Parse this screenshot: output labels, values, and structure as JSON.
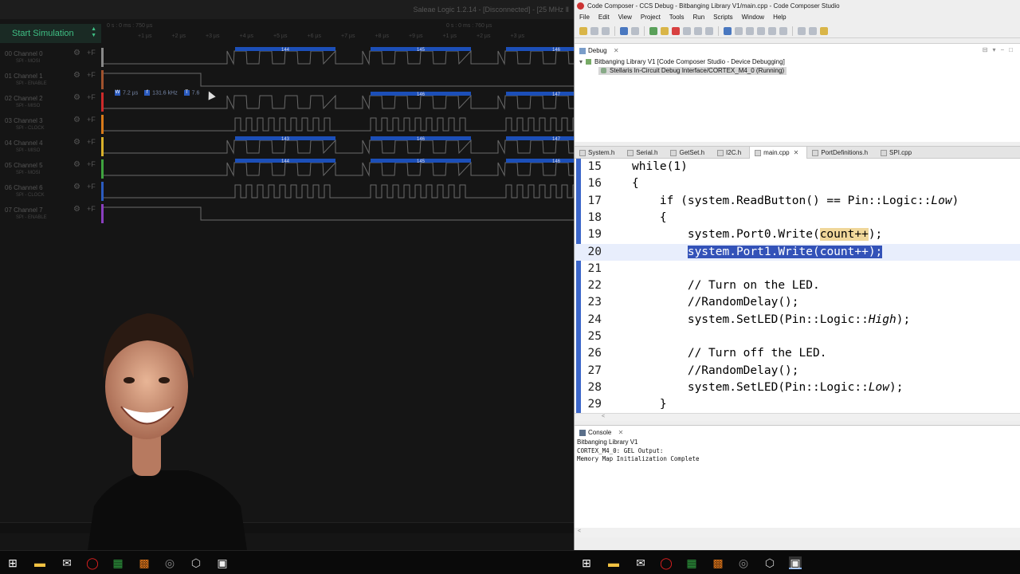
{
  "saleae": {
    "window_title": "Saleae Logic 1.2.14 - [Disconnected] - [25 MHz Ⅱ",
    "start_simulation_label": "Start Simulation",
    "ruler_left": "0 s : 0 ms : 750 µs",
    "ruler_right": "0 s : 0 ms : 760 µs",
    "ruler_ticks": [
      "+1 µs",
      "+2 µs",
      "+3 µs",
      "+4 µs",
      "+5 µs",
      "+6 µs",
      "+7 µs",
      "+8 µs",
      "+9 µs",
      "+1 µs",
      "+2 µs",
      "+3 µs"
    ],
    "channels": [
      {
        "num": "00",
        "name": "Channel 0",
        "sub": "SPI - MOSI",
        "color": "#888888",
        "labels": [
          "144",
          "145",
          "146"
        ],
        "type": "bytes"
      },
      {
        "num": "01",
        "name": "Channel 1",
        "sub": "SPI - ENABLE",
        "color": "#a0522d",
        "labels": [],
        "type": "enable"
      },
      {
        "num": "02",
        "name": "Channel 2",
        "sub": "SPI - MISO",
        "color": "#cc2a2a",
        "labels": [
          "146",
          "147"
        ],
        "type": "bytes"
      },
      {
        "num": "03",
        "name": "Channel 3",
        "sub": "SPI - CLOCK",
        "color": "#d87a1a",
        "labels": [],
        "type": "clock"
      },
      {
        "num": "04",
        "name": "Channel 4",
        "sub": "SPI - MISO",
        "color": "#d9b02a",
        "labels": [
          "143",
          "146",
          "147"
        ],
        "type": "bytes"
      },
      {
        "num": "05",
        "name": "Channel 5",
        "sub": "SPI - MOSI",
        "color": "#3fa33f",
        "labels": [
          "144",
          "145",
          "146"
        ],
        "type": "bytes"
      },
      {
        "num": "06",
        "name": "Channel 6",
        "sub": "SPI - CLOCK",
        "color": "#2b5bbf",
        "labels": [],
        "type": "clock"
      },
      {
        "num": "07",
        "name": "Channel 7",
        "sub": "SPI - ENABLE",
        "color": "#8a3fbf",
        "labels": [],
        "type": "enable"
      }
    ],
    "measurement": {
      "w": "7.2 µs",
      "f": "131.6 kHz",
      "t": "7.6"
    }
  },
  "ccs": {
    "window_title": "Code Composer - CCS Debug - Bitbanging Library V1/main.cpp - Code Composer Studio",
    "menu": [
      "File",
      "Edit",
      "View",
      "Project",
      "Tools",
      "Run",
      "Scripts",
      "Window",
      "Help"
    ],
    "debug_tab": "Debug",
    "debug_tree": {
      "root": "Bitbanging Library V1 [Code Composer Studio - Device Debugging]",
      "child": "Stellaris In-Circuit Debug Interface/CORTEX_M4_0 (Running)"
    },
    "editor_tabs": [
      "System.h",
      "Serial.h",
      "GetSet.h",
      "I2C.h",
      "main.cpp",
      "PortDefinitions.h",
      "SPI.cpp"
    ],
    "active_tab": "main.cpp",
    "code_lines": [
      {
        "num": "15",
        "text": "while(1)"
      },
      {
        "num": "16",
        "text": "{"
      },
      {
        "num": "17",
        "text": "    if (system.ReadButton() == Pin::Logic::Low)"
      },
      {
        "num": "18",
        "text": "    {"
      },
      {
        "num": "19",
        "text": "        system.Port0.Write(count++);"
      },
      {
        "num": "20",
        "text": "        system.Port1.Write(count++);"
      },
      {
        "num": "21",
        "text": ""
      },
      {
        "num": "22",
        "text": "        // Turn on the LED."
      },
      {
        "num": "23",
        "text": "        //RandomDelay();"
      },
      {
        "num": "24",
        "text": "        system.SetLED(Pin::Logic::High);"
      },
      {
        "num": "25",
        "text": ""
      },
      {
        "num": "26",
        "text": "        // Turn off the LED."
      },
      {
        "num": "27",
        "text": "        //RandomDelay();"
      },
      {
        "num": "28",
        "text": "        system.SetLED(Pin::Logic::Low);"
      },
      {
        "num": "29",
        "text": "    }"
      }
    ],
    "console": {
      "tab": "Console",
      "sub": "Bitbanging Library V1",
      "output": "CORTEX_M4_0: GEL Output:\nMemory Map Initialization Complete"
    }
  },
  "taskbar": {
    "icons": [
      "windows-start-icon",
      "file-explorer-icon",
      "mail-icon",
      "opera-icon",
      "excel-icon",
      "calendar-icon",
      "disk-icon",
      "package-icon",
      "app-window-icon"
    ]
  }
}
